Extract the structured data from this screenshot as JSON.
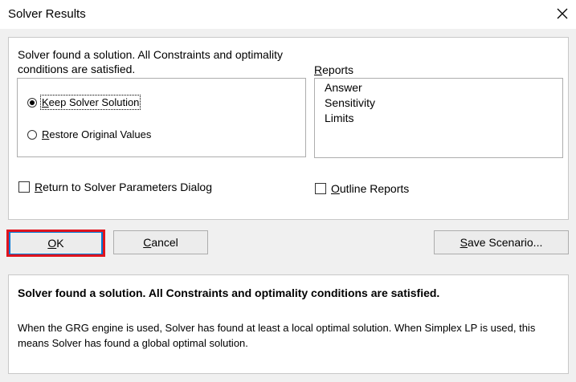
{
  "window": {
    "title": "Solver Results",
    "close_icon": "close-icon"
  },
  "top": {
    "message": "Solver found a solution.  All Constraints and optimality conditions are satisfied.",
    "keep_label_first": "K",
    "keep_label_rest": "eep Solver Solution",
    "restore_label_first": "R",
    "restore_label_rest": "estore Original Values",
    "keep_selected": true,
    "reports_label_first": "R",
    "reports_label_rest": "eports",
    "reports": [
      "Answer",
      "Sensitivity",
      "Limits"
    ],
    "return_label_first": "R",
    "return_label_rest": "eturn to Solver Parameters Dialog",
    "outline_label_first": "O",
    "outline_label_rest": "utline Reports"
  },
  "buttons": {
    "ok_first": "O",
    "ok_rest": "K",
    "cancel_first": "C",
    "cancel_rest": "ancel",
    "save_first": "S",
    "save_rest": "ave Scenario..."
  },
  "bottom": {
    "bold_message": "Solver found a solution.  All Constraints and optimality conditions are satisfied.",
    "description": "When the GRG engine is used, Solver has found at least a local optimal solution. When Simplex LP is used, this means Solver has found a global optimal solution."
  },
  "colors": {
    "highlight": "#e0141e",
    "default_button_border": "#0078d4"
  }
}
